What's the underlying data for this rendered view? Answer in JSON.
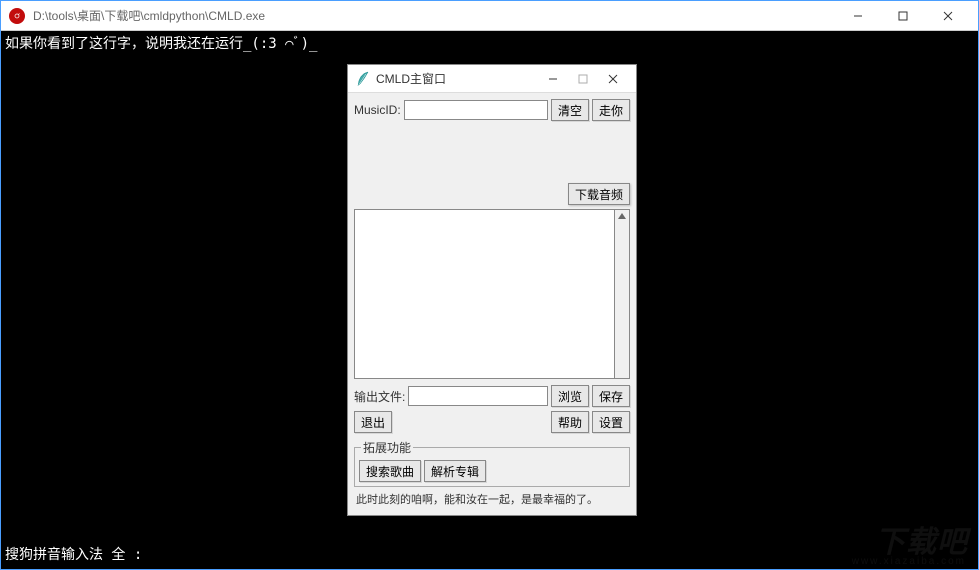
{
  "console": {
    "title": "D:\\tools\\桌面\\下载吧\\cmldpython\\CMLD.exe",
    "running_text": "如果你看到了这行字，说明我还在运行_(:3 ⌒ﾞ)_"
  },
  "child": {
    "title": "CMLD主窗口",
    "labels": {
      "music_id": "MusicID:",
      "output_file": "输出文件:"
    },
    "buttons": {
      "clear": "清空",
      "go": "走你",
      "download_audio": "下载音频",
      "browse": "浏览",
      "save": "保存",
      "exit": "退出",
      "help": "帮助",
      "settings": "设置",
      "search_song": "搜索歌曲",
      "parse_album": "解析专辑"
    },
    "fieldset_title": "拓展功能",
    "status_text": "此时此刻的咱啊，能和汝在一起，是最幸福的了。"
  },
  "ime": "搜狗拼音输入法  全 :",
  "watermark": {
    "main": "下载吧",
    "sub": "www.xiazaiba.com"
  }
}
